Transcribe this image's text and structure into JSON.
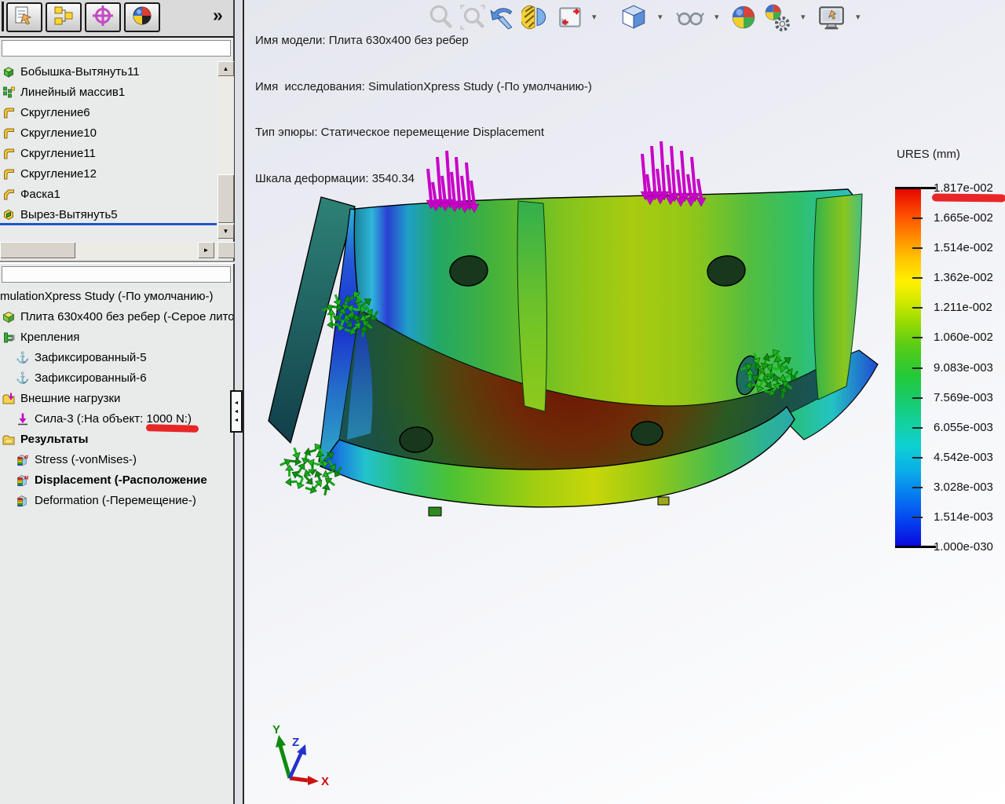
{
  "manager_tabs": {
    "overflow_label": "»",
    "tabs": [
      {
        "icon": "propertymanager-icon"
      },
      {
        "icon": "configurationmanager-icon"
      },
      {
        "icon": "dimxpertmanager-icon"
      },
      {
        "icon": "displaymanager-icon"
      }
    ]
  },
  "feature_tree": {
    "items": [
      {
        "label": "Бобышка-Вытянуть11",
        "icon": "boss-extrude-icon"
      },
      {
        "label": "Линейный массив1",
        "icon": "linear-pattern-icon"
      },
      {
        "label": "Скругление6",
        "icon": "fillet-icon"
      },
      {
        "label": "Скругление10",
        "icon": "fillet-icon"
      },
      {
        "label": "Скругление11",
        "icon": "fillet-icon"
      },
      {
        "label": "Скругление12",
        "icon": "fillet-icon"
      },
      {
        "label": "Фаска1",
        "icon": "chamfer-icon"
      },
      {
        "label": "Вырез-Вытянуть5",
        "icon": "cut-extrude-icon"
      }
    ]
  },
  "simulation_tree": {
    "items": [
      {
        "label": "mulationXpress Study (-По умолчанию-)",
        "icon": "",
        "indent": 0,
        "bold": false
      },
      {
        "label": "Плита 630x400 без ребер (-Серое лито",
        "icon": "part-icon",
        "indent": 0,
        "bold": false
      },
      {
        "label": "Крепления",
        "icon": "fixtures-icon",
        "indent": 0,
        "bold": false
      },
      {
        "label": "Зафиксированный-5",
        "icon": "fixed-restraint-icon",
        "indent": 1,
        "bold": false
      },
      {
        "label": "Зафиксированный-6",
        "icon": "fixed-restraint-icon",
        "indent": 1,
        "bold": false
      },
      {
        "label": "Внешние нагрузки",
        "icon": "external-loads-icon",
        "indent": 0,
        "bold": false
      },
      {
        "label": "Сила-3 (:На объект: 1000 N:)",
        "icon": "force-icon",
        "indent": 1,
        "bold": false
      },
      {
        "label": "Результаты",
        "icon": "results-folder-icon",
        "indent": 0,
        "bold": true
      },
      {
        "label": "Stress (-vonMises-)",
        "icon": "stress-plot-icon",
        "indent": 1,
        "bold": false
      },
      {
        "label": "Displacement (-Расположение",
        "icon": "displacement-plot-icon",
        "indent": 1,
        "bold": true
      },
      {
        "label": "Deformation (-Перемещение-)",
        "icon": "deformation-plot-icon",
        "indent": 1,
        "bold": false
      }
    ]
  },
  "annotations": {
    "lines": [
      "Имя модели: Плита 630x400 без ребер",
      "Имя  исследования: SimulationXpress Study (-По умолчанию-)",
      "Тип эпюры: Статическое перемещение Displacement",
      "Шкала деформации: 3540.34"
    ]
  },
  "heads_up_toolbar": {
    "icons": [
      {
        "name": "zoom-fit-icon",
        "dropdown": false,
        "disabled": true
      },
      {
        "name": "zoom-area-icon",
        "dropdown": false,
        "disabled": true
      },
      {
        "name": "previous-view-icon",
        "dropdown": false,
        "disabled": false
      },
      {
        "name": "section-view-icon",
        "dropdown": false,
        "disabled": false
      },
      {
        "name": "viewport-icon",
        "dropdown": true,
        "disabled": false
      },
      {
        "name": "view-orientation-icon",
        "dropdown": true,
        "disabled": false
      },
      {
        "name": "display-style-icon",
        "dropdown": true,
        "disabled": false
      },
      {
        "name": "shadows-icon",
        "dropdown": false,
        "disabled": false
      },
      {
        "name": "appearance-icon",
        "dropdown": true,
        "disabled": false
      },
      {
        "name": "view-settings-icon",
        "dropdown": true,
        "disabled": false
      }
    ]
  },
  "legend": {
    "title": "URES (mm)",
    "values": [
      "1.817e-002",
      "1.665e-002",
      "1.514e-002",
      "1.362e-002",
      "1.211e-002",
      "1.060e-002",
      "9.083e-003",
      "7.569e-003",
      "6.055e-003",
      "4.542e-003",
      "3.028e-003",
      "1.514e-003",
      "1.000e-030"
    ]
  },
  "triad": {
    "x": "X",
    "y": "Y",
    "z": "Z"
  },
  "glyphs": {
    "up": "▲",
    "down": "▼",
    "right": "►",
    "left": "◄",
    "caret": "▾"
  },
  "colors": {
    "force_arrows": "#c800c8",
    "fixture_arrows": "#15a215",
    "rollback_bar": "#1f55cc",
    "marker_red": "#e81515"
  }
}
